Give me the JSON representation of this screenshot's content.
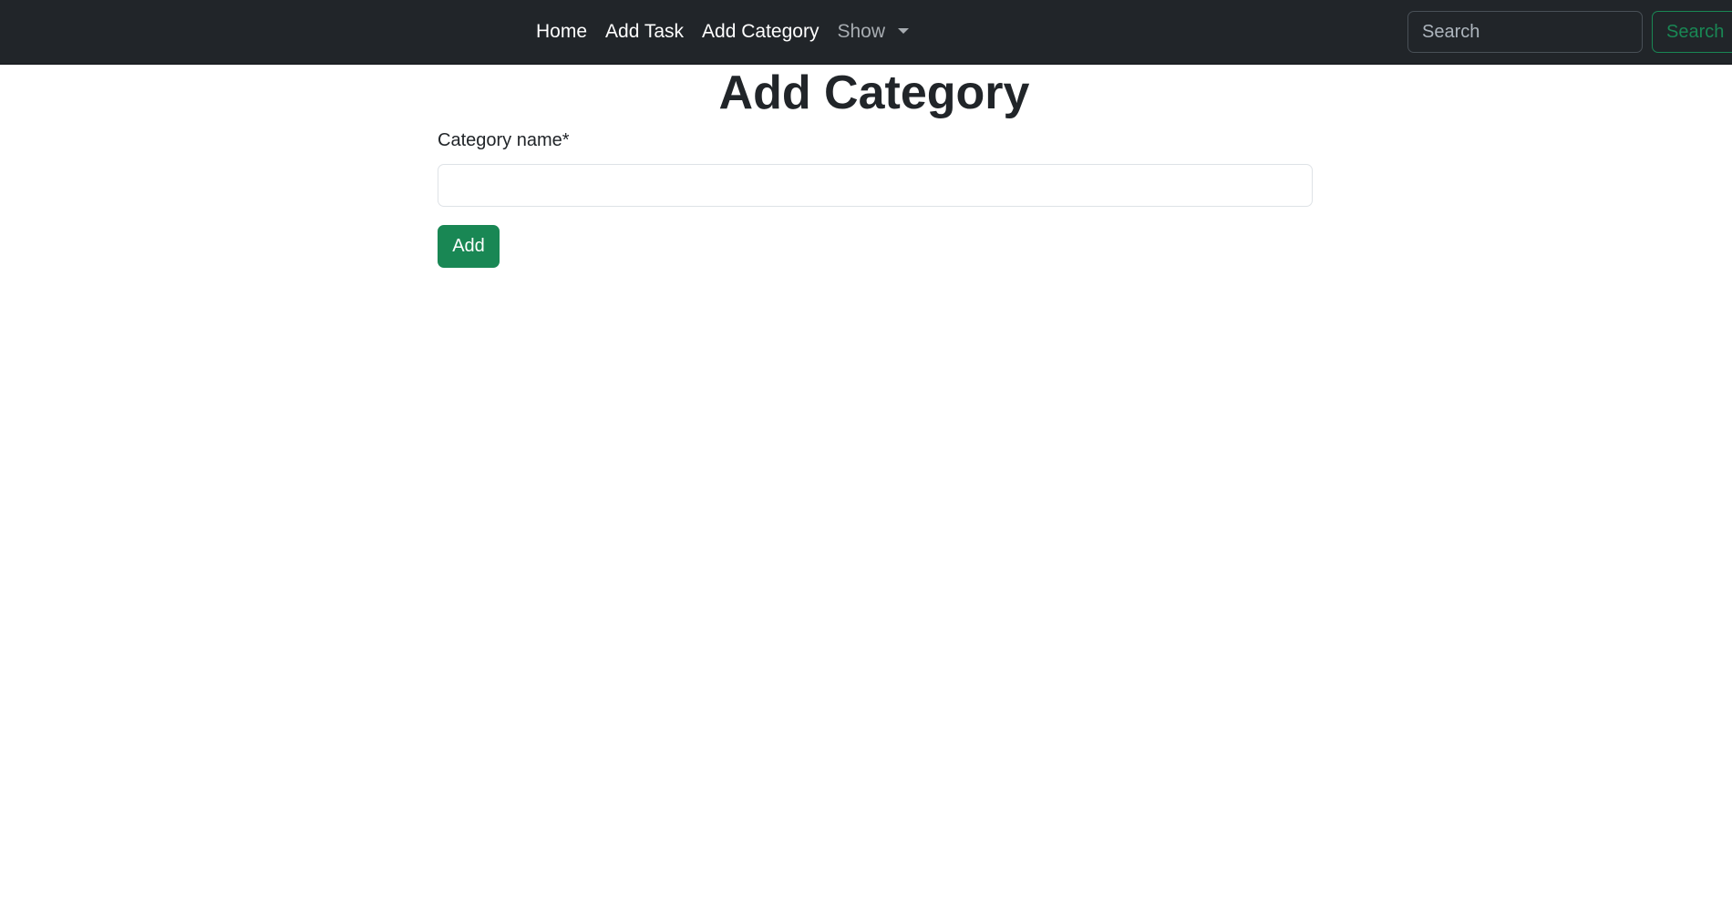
{
  "navbar": {
    "links": [
      {
        "label": "Home"
      },
      {
        "label": "Add Task"
      },
      {
        "label": "Add Category"
      },
      {
        "label": "Show"
      }
    ],
    "search_placeholder": "Search",
    "search_button_label": "Search"
  },
  "main": {
    "title": "Add Category",
    "form": {
      "category_label": "Category name*",
      "category_value": "",
      "submit_label": "Add"
    }
  },
  "colors": {
    "navbar_bg": "#212529",
    "success": "#198754",
    "text": "#212529"
  },
  "icons": {
    "dropdown": "chevron-down-icon"
  }
}
